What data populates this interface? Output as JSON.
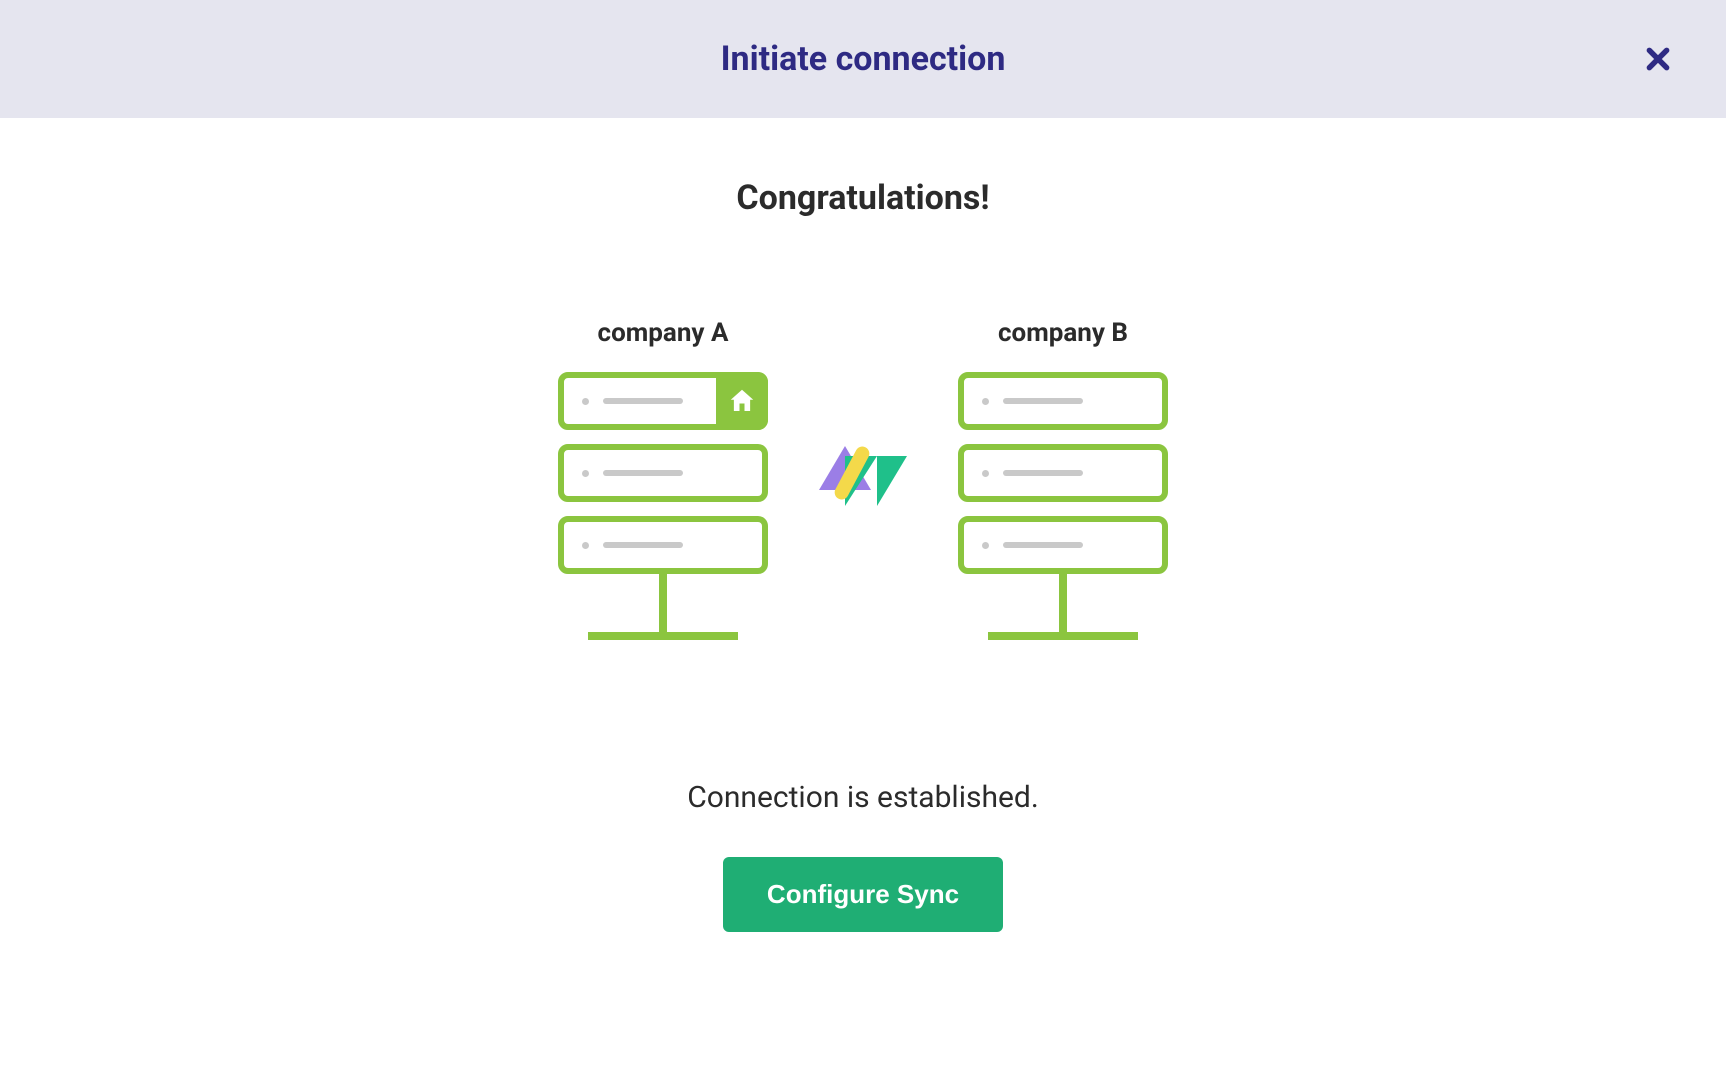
{
  "modal": {
    "title": "Initiate connection",
    "close_icon": "close-icon"
  },
  "body": {
    "heading": "Congratulations!",
    "companyA_label": "company A",
    "companyB_label": "company B",
    "status": "Connection is established.",
    "configure_button": "Configure Sync"
  },
  "colors": {
    "header_bg": "#e5e5ef",
    "title": "#2e2a83",
    "accent_green": "#8bc53f",
    "button_green": "#1fae74",
    "logo_purple": "#9b7ee6",
    "logo_teal": "#1fc08a",
    "logo_yellow": "#f4d94a"
  }
}
